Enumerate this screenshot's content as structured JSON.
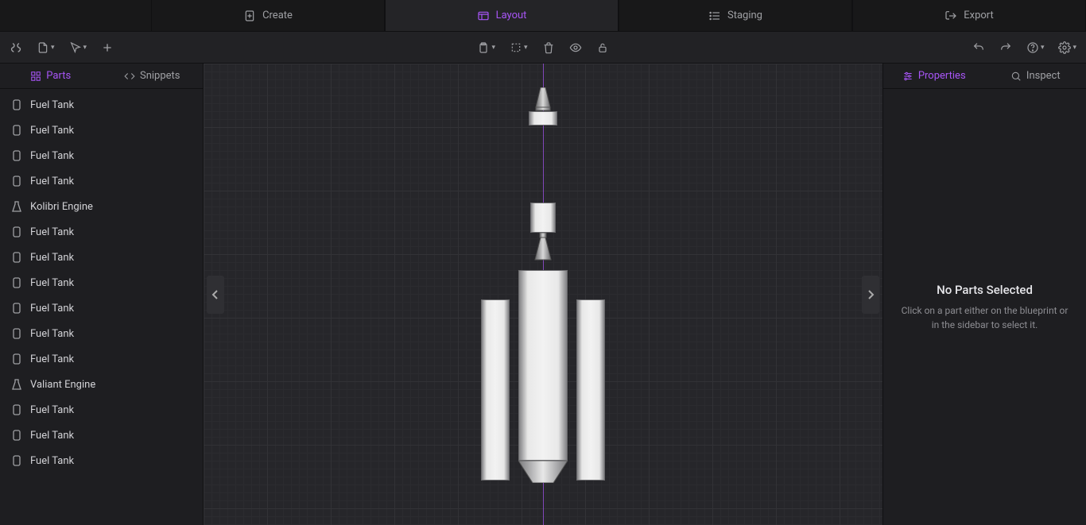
{
  "topTabs": [
    {
      "label": "Create",
      "icon": "create"
    },
    {
      "label": "Layout",
      "icon": "layout",
      "active": true
    },
    {
      "label": "Staging",
      "icon": "staging"
    },
    {
      "label": "Export",
      "icon": "export"
    }
  ],
  "sidebarTabs": {
    "parts": "Parts",
    "snippets": "Snippets"
  },
  "rightTabs": {
    "properties": "Properties",
    "inspect": "Inspect"
  },
  "partsList": [
    {
      "label": "Fuel Tank",
      "type": "tank"
    },
    {
      "label": "Fuel Tank",
      "type": "tank"
    },
    {
      "label": "Fuel Tank",
      "type": "tank"
    },
    {
      "label": "Fuel Tank",
      "type": "tank"
    },
    {
      "label": "Kolibri Engine",
      "type": "engine"
    },
    {
      "label": "Fuel Tank",
      "type": "tank"
    },
    {
      "label": "Fuel Tank",
      "type": "tank"
    },
    {
      "label": "Fuel Tank",
      "type": "tank"
    },
    {
      "label": "Fuel Tank",
      "type": "tank"
    },
    {
      "label": "Fuel Tank",
      "type": "tank"
    },
    {
      "label": "Fuel Tank",
      "type": "tank"
    },
    {
      "label": "Valiant Engine",
      "type": "engine"
    },
    {
      "label": "Fuel Tank",
      "type": "tank"
    },
    {
      "label": "Fuel Tank",
      "type": "tank"
    },
    {
      "label": "Fuel Tank",
      "type": "tank"
    }
  ],
  "emptyState": {
    "title": "No Parts Selected",
    "sub": "Click on a part either on the blueprint or in the sidebar to select it."
  },
  "accentColor": "#a855f7"
}
